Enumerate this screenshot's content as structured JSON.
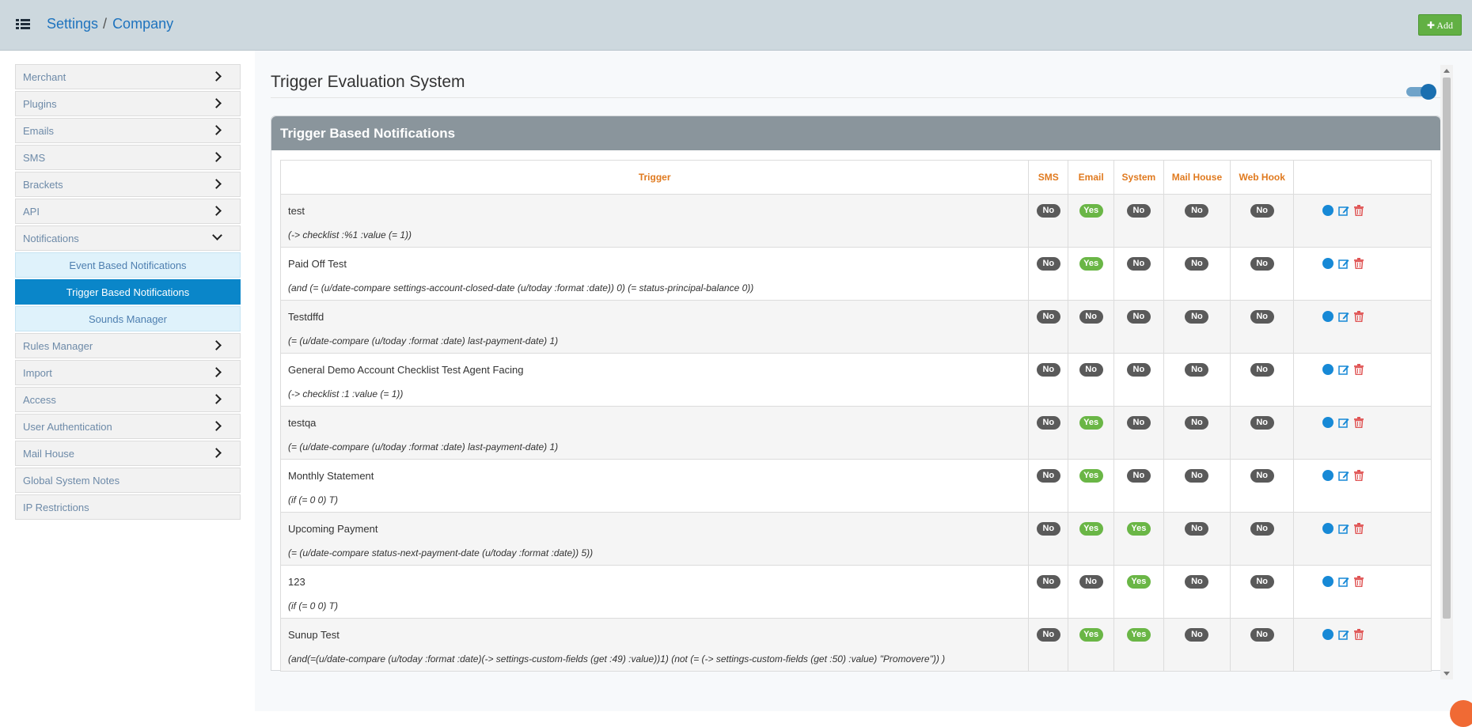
{
  "header": {
    "breadcrumb": [
      "Settings",
      "Company"
    ],
    "separator": "/",
    "add_label": "✚ Add"
  },
  "sidebar": {
    "items": [
      {
        "label": "Merchant",
        "chevron": "right"
      },
      {
        "label": "Plugins",
        "chevron": "right"
      },
      {
        "label": "Emails",
        "chevron": "right"
      },
      {
        "label": "SMS",
        "chevron": "right"
      },
      {
        "label": "Brackets",
        "chevron": "right"
      },
      {
        "label": "API",
        "chevron": "right"
      },
      {
        "label": "Notifications",
        "chevron": "down"
      }
    ],
    "sub_items": [
      {
        "label": "Event Based Notifications",
        "active": false
      },
      {
        "label": "Trigger Based Notifications",
        "active": true
      },
      {
        "label": "Sounds Manager",
        "active": false
      }
    ],
    "items_after": [
      {
        "label": "Rules Manager",
        "chevron": "right"
      },
      {
        "label": "Import",
        "chevron": "right"
      },
      {
        "label": "Access",
        "chevron": "right"
      },
      {
        "label": "User Authentication",
        "chevron": "right"
      },
      {
        "label": "Mail House",
        "chevron": "right"
      },
      {
        "label": "Global System Notes",
        "chevron": "none"
      },
      {
        "label": "IP Restrictions",
        "chevron": "none"
      }
    ]
  },
  "main": {
    "section_title": "Trigger Evaluation System",
    "toggle_on": true,
    "panel_title": "Trigger Based Notifications",
    "columns": [
      "Trigger",
      "SMS",
      "Email",
      "System",
      "Mail House",
      "Web Hook",
      ""
    ],
    "rows": [
      {
        "name": "test",
        "expr": "(-> checklist :%1 :value (= 1))",
        "flags": [
          "No",
          "Yes",
          "No",
          "No",
          "No"
        ]
      },
      {
        "name": "Paid Off Test",
        "expr": "(and (= (u/date-compare settings-account-closed-date (u/today :format :date)) 0) (= status-principal-balance 0))",
        "flags": [
          "No",
          "Yes",
          "No",
          "No",
          "No"
        ]
      },
      {
        "name": "Testdffd",
        "expr": "(= (u/date-compare (u/today :format :date) last-payment-date) 1)",
        "flags": [
          "No",
          "No",
          "No",
          "No",
          "No"
        ]
      },
      {
        "name": "General Demo Account Checklist Test Agent Facing",
        "expr": "(-> checklist :1 :value (= 1))",
        "flags": [
          "No",
          "No",
          "No",
          "No",
          "No"
        ]
      },
      {
        "name": "testqa",
        "expr": "(= (u/date-compare (u/today :format :date) last-payment-date) 1)",
        "flags": [
          "No",
          "Yes",
          "No",
          "No",
          "No"
        ]
      },
      {
        "name": "Monthly Statement",
        "expr": "(if (= 0 0) T)",
        "flags": [
          "No",
          "Yes",
          "No",
          "No",
          "No"
        ]
      },
      {
        "name": "Upcoming Payment",
        "expr": "(= (u/date-compare status-next-payment-date (u/today :format :date)) 5))",
        "flags": [
          "No",
          "Yes",
          "Yes",
          "No",
          "No"
        ]
      },
      {
        "name": "123",
        "expr": "(if (= 0 0) T)",
        "flags": [
          "No",
          "No",
          "Yes",
          "No",
          "No"
        ]
      },
      {
        "name": "Sunup Test",
        "expr": "(and(=(u/date-compare (u/today :format :date)(-> settings-custom-fields (get :49) :value))1) (not (= (-> settings-custom-fields (get :50) :value) \"Promovere\")) )",
        "flags": [
          "No",
          "Yes",
          "Yes",
          "No",
          "No"
        ]
      }
    ],
    "actions": [
      "view-icon",
      "edit-icon",
      "delete-icon"
    ]
  },
  "colors": {
    "accent_blue": "#0a86c9",
    "yes_green": "#6ab646",
    "no_gray": "#5a5a5a",
    "header_orange": "#e07a1f",
    "add_green": "#62b044"
  }
}
